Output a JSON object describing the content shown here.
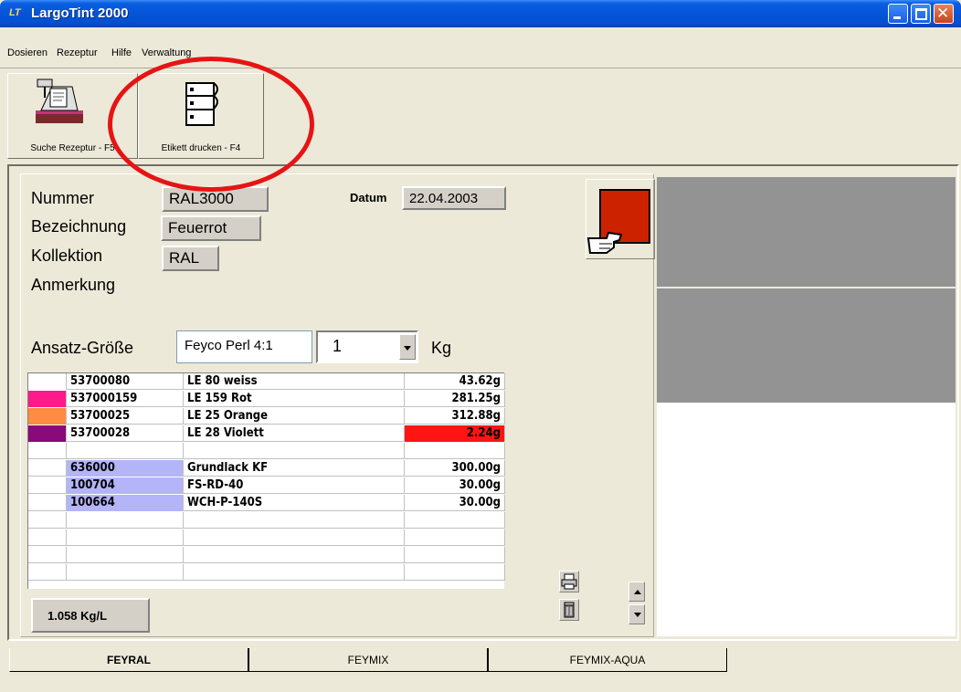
{
  "window": {
    "logo_text": "LT",
    "title": "LargoTint 2000"
  },
  "menu": [
    "Dosieren",
    "Rezeptur",
    "Hilfe",
    "Verwaltung"
  ],
  "toolbar": {
    "search_label": "Suche Rezeptur - F5",
    "print_label": "Etikett drucken - F4"
  },
  "recipe": {
    "nummer_label": "Nummer",
    "nummer_value": "RAL3000",
    "bezeichnung_label": "Bezeichnung",
    "bezeichnung_value": "Feuerrot",
    "kollektion_label": "Kollektion",
    "kollektion_value": "RAL",
    "anmerkung_label": "Anmerkung",
    "datum_label": "Datum",
    "datum_value": "22.04.2003",
    "color_hex": "#cc2200"
  },
  "ansatz": {
    "label": "Ansatz-Größe",
    "product": "Feyco Perl 4:1",
    "quantity": "1",
    "unit": "Kg"
  },
  "components": [
    {
      "color": "#ffffff",
      "code": "53700080",
      "name": "LE 80 weiss",
      "amount": "43.62g",
      "highlight": ""
    },
    {
      "color": "#ff1a8c",
      "code": "537000159",
      "name": "LE 159 Rot",
      "amount": "281.25g",
      "highlight": ""
    },
    {
      "color": "#ff8c42",
      "code": "53700025",
      "name": "LE 25 Orange",
      "amount": "312.88g",
      "highlight": ""
    },
    {
      "color": "#8a0a7a",
      "code": "53700028",
      "name": "LE 28 Violett",
      "amount": "2.24g",
      "highlight": "#ff1414"
    },
    {
      "color": "",
      "code": "",
      "name": "",
      "amount": "",
      "highlight": ""
    },
    {
      "color": "",
      "code": "636000",
      "name": "Grundlack KF",
      "amount": "300.00g",
      "highlight": ""
    },
    {
      "color": "",
      "code": "100704",
      "name": "FS-RD-40",
      "amount": "30.00g",
      "highlight": ""
    },
    {
      "color": "",
      "code": "100664",
      "name": "WCH-P-140S",
      "amount": "30.00g",
      "highlight": ""
    },
    {
      "color": "",
      "code": "",
      "name": "",
      "amount": "",
      "highlight": ""
    },
    {
      "color": "",
      "code": "",
      "name": "",
      "amount": "",
      "highlight": ""
    },
    {
      "color": "",
      "code": "",
      "name": "",
      "amount": "",
      "highlight": ""
    },
    {
      "color": "",
      "code": "",
      "name": "",
      "amount": "",
      "highlight": ""
    }
  ],
  "base_code_color": "#b4b4f8",
  "density": "1.058 Kg/L",
  "tabs": [
    "FEYRAL",
    "FEYMIX",
    "FEYMIX-AQUA"
  ]
}
